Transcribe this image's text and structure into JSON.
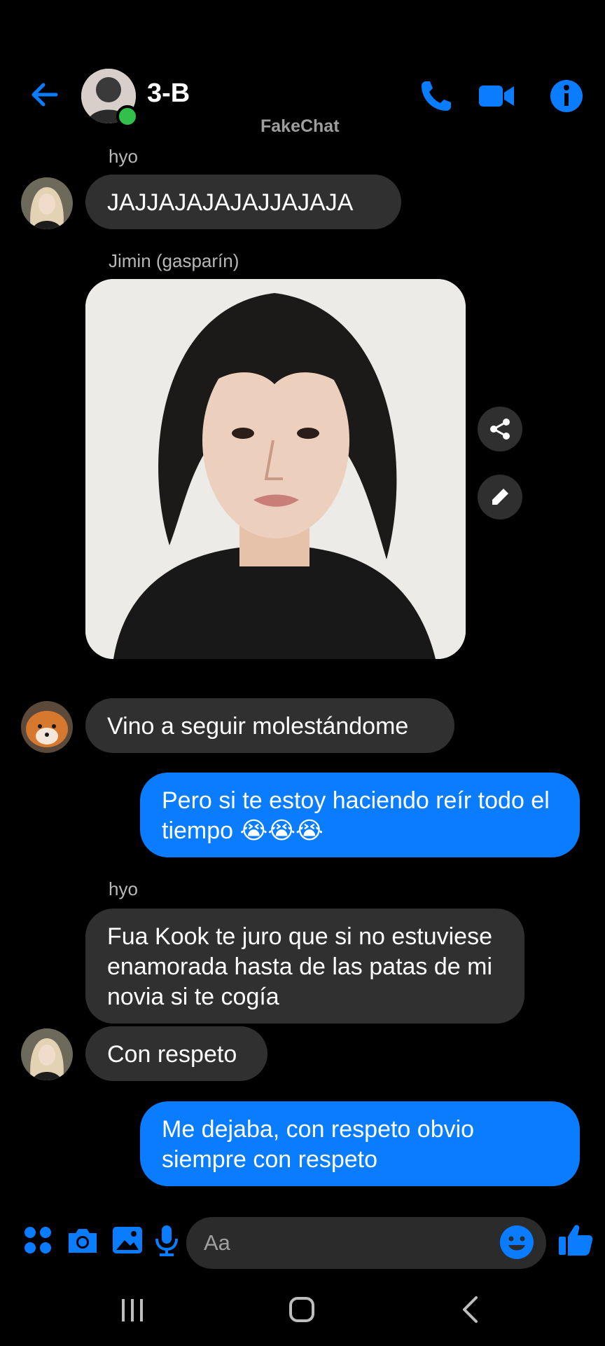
{
  "header": {
    "title": "3-B",
    "watermark": "FakeChat",
    "accent_color": "#0a7cff",
    "icons": [
      "back-arrow-icon",
      "phone-icon",
      "video-camera-icon",
      "info-icon"
    ]
  },
  "messages": [
    {
      "sender": "hyo",
      "direction": "incoming",
      "text": "JAJJAJAJAJAJJAJAJA",
      "avatar": "girl-avatar"
    },
    {
      "sender": "Jimin (gasparín)",
      "direction": "incoming",
      "type": "photo",
      "photo_description_icon": "photo-person-icon"
    },
    {
      "direction": "incoming",
      "text": "Vino a seguir molestándome",
      "avatar": "fox-avatar"
    },
    {
      "direction": "outgoing",
      "text": "Pero si te estoy haciendo reír todo el tiempo 😭😭😭"
    },
    {
      "sender": "hyo",
      "direction": "incoming",
      "text": "Fua Kook te juro que si no estuviese enamorada hasta de las patas de mi novia si te cogía"
    },
    {
      "direction": "incoming",
      "text": "Con respeto",
      "avatar": "girl-avatar"
    },
    {
      "direction": "outgoing",
      "text": "Me dejaba, con respeto obvio siempre con respeto"
    }
  ],
  "composer": {
    "placeholder": "Aa",
    "icons": [
      "apps-grid-icon",
      "camera-icon",
      "gallery-icon",
      "microphone-icon",
      "emoji-icon",
      "thumbs-up-icon"
    ]
  },
  "nav": {
    "icons": [
      "recent-apps-icon",
      "home-icon",
      "back-icon"
    ]
  }
}
